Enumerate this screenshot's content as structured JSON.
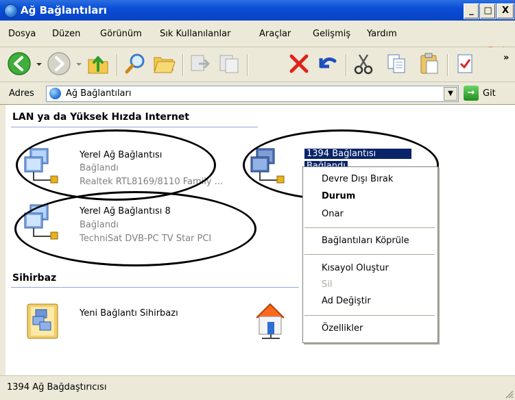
{
  "window": {
    "title": "Ağ Bağlantıları",
    "min_label": "_",
    "max_label": "□",
    "close_label": "X"
  },
  "menu": {
    "items": [
      "Dosya",
      "Düzen",
      "Görünüm",
      "Sık Kullanılanlar",
      "Araçlar",
      "Gelişmiş",
      "Yardım"
    ]
  },
  "toolbar": {
    "more_label": "»"
  },
  "address": {
    "label": "Adres",
    "value": "Ağ Bağlantıları",
    "go_label": "Git",
    "dropdown_glyph": "▼",
    "go_glyph": "→"
  },
  "groups": {
    "lan": {
      "heading": "LAN ya da Yüksek Hızda Internet",
      "items": [
        {
          "title": "Yerel Ağ Bağlantısı",
          "status": "Bağlandı",
          "device": "Realtek RTL8169/8110 Family ..."
        },
        {
          "title": "1394 Bağlantısı",
          "status": "Bağlandı"
        },
        {
          "title": "Yerel Ağ Bağlantısı 8",
          "status": "Bağlandı",
          "device": "TechniSat DVB-PC TV Star PCI"
        }
      ]
    },
    "wizard": {
      "heading": "Sihirbaz",
      "items": [
        {
          "title": "Yeni Bağlantı Sihirbazı"
        }
      ]
    }
  },
  "context_menu": {
    "items": [
      {
        "label": "Devre Dışı Bırak",
        "bold": false,
        "disabled": false
      },
      {
        "label": "Durum",
        "bold": true,
        "disabled": false
      },
      {
        "label": "Onar",
        "bold": false,
        "disabled": false
      },
      {
        "label": "Bağlantıları Köprüle",
        "bold": false,
        "disabled": false
      },
      {
        "label": "Kısayol Oluştur",
        "bold": false,
        "disabled": false
      },
      {
        "label": "Sil",
        "bold": false,
        "disabled": true
      },
      {
        "label": "Ad Değiştir",
        "bold": false,
        "disabled": false
      },
      {
        "label": "Özellikler",
        "bold": false,
        "disabled": false
      }
    ]
  },
  "statusbar": {
    "text": "1394 Ağ Bağdaştırıcısı"
  },
  "colors": {
    "titlebar": "#0a4ed6",
    "selection": "#0a246a",
    "chrome": "#ece9d8"
  }
}
